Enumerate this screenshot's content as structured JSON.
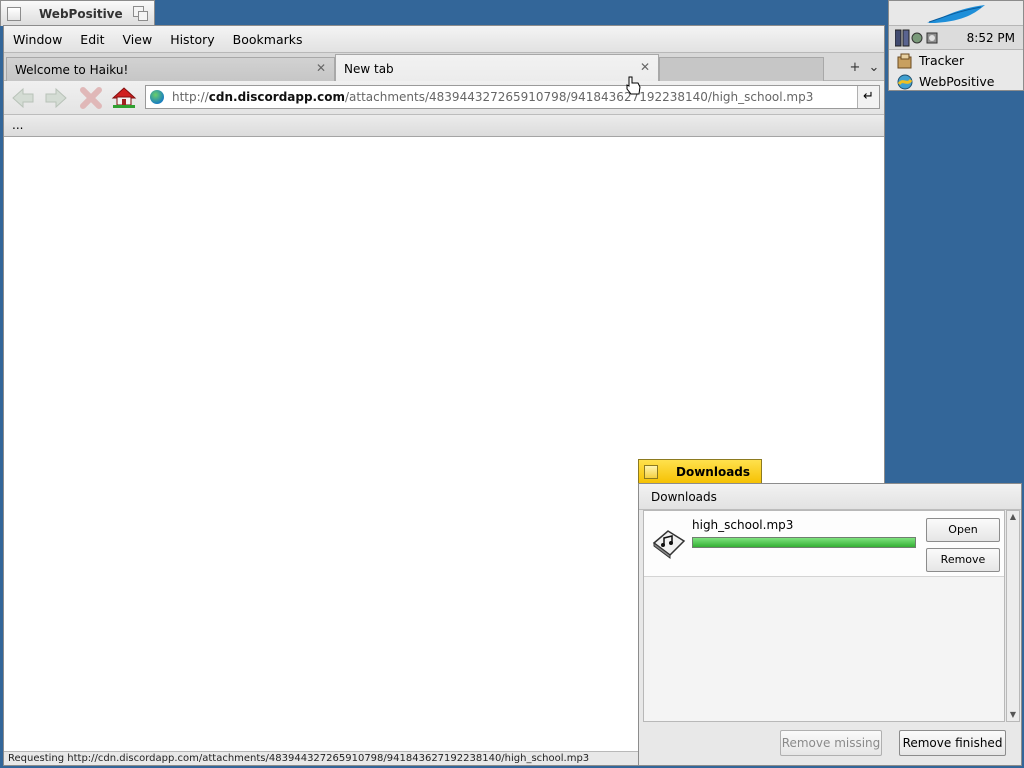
{
  "browser": {
    "window_title": "WebPositive",
    "menu": [
      "Window",
      "Edit",
      "View",
      "History",
      "Bookmarks"
    ],
    "tabs": [
      {
        "label": "Welcome to Haiku!",
        "active": false
      },
      {
        "label": "New tab",
        "active": true
      }
    ],
    "tab_controls": {
      "new_tab": "+",
      "tab_menu": "⌄"
    },
    "url": {
      "scheme": "http://",
      "host": "cdn.discordapp.com",
      "path": "/attachments/483944327265910798/941843627192238140/high_school.mp3"
    },
    "go_button": "↵",
    "bookmark_bar_overflow": "...",
    "status_text": "Requesting http://cdn.discordapp.com/attachments/483944327265910798/941843627192238140/high_school.mp3"
  },
  "deskbar": {
    "clock": "8:52 PM",
    "apps": [
      "Tracker",
      "WebPositive"
    ],
    "leaf_color": "#1e8fd9"
  },
  "downloads": {
    "window_title": "Downloads",
    "menu_label": "Downloads",
    "items": [
      {
        "filename": "high_school.mp3",
        "progress": 1.0,
        "open_label": "Open",
        "remove_label": "Remove"
      }
    ],
    "remove_missing_label": "Remove missing",
    "remove_finished_label": "Remove finished",
    "accent": "#f5c000"
  },
  "colors": {
    "desktop": "#336699",
    "progress_fill": "#34b034"
  }
}
